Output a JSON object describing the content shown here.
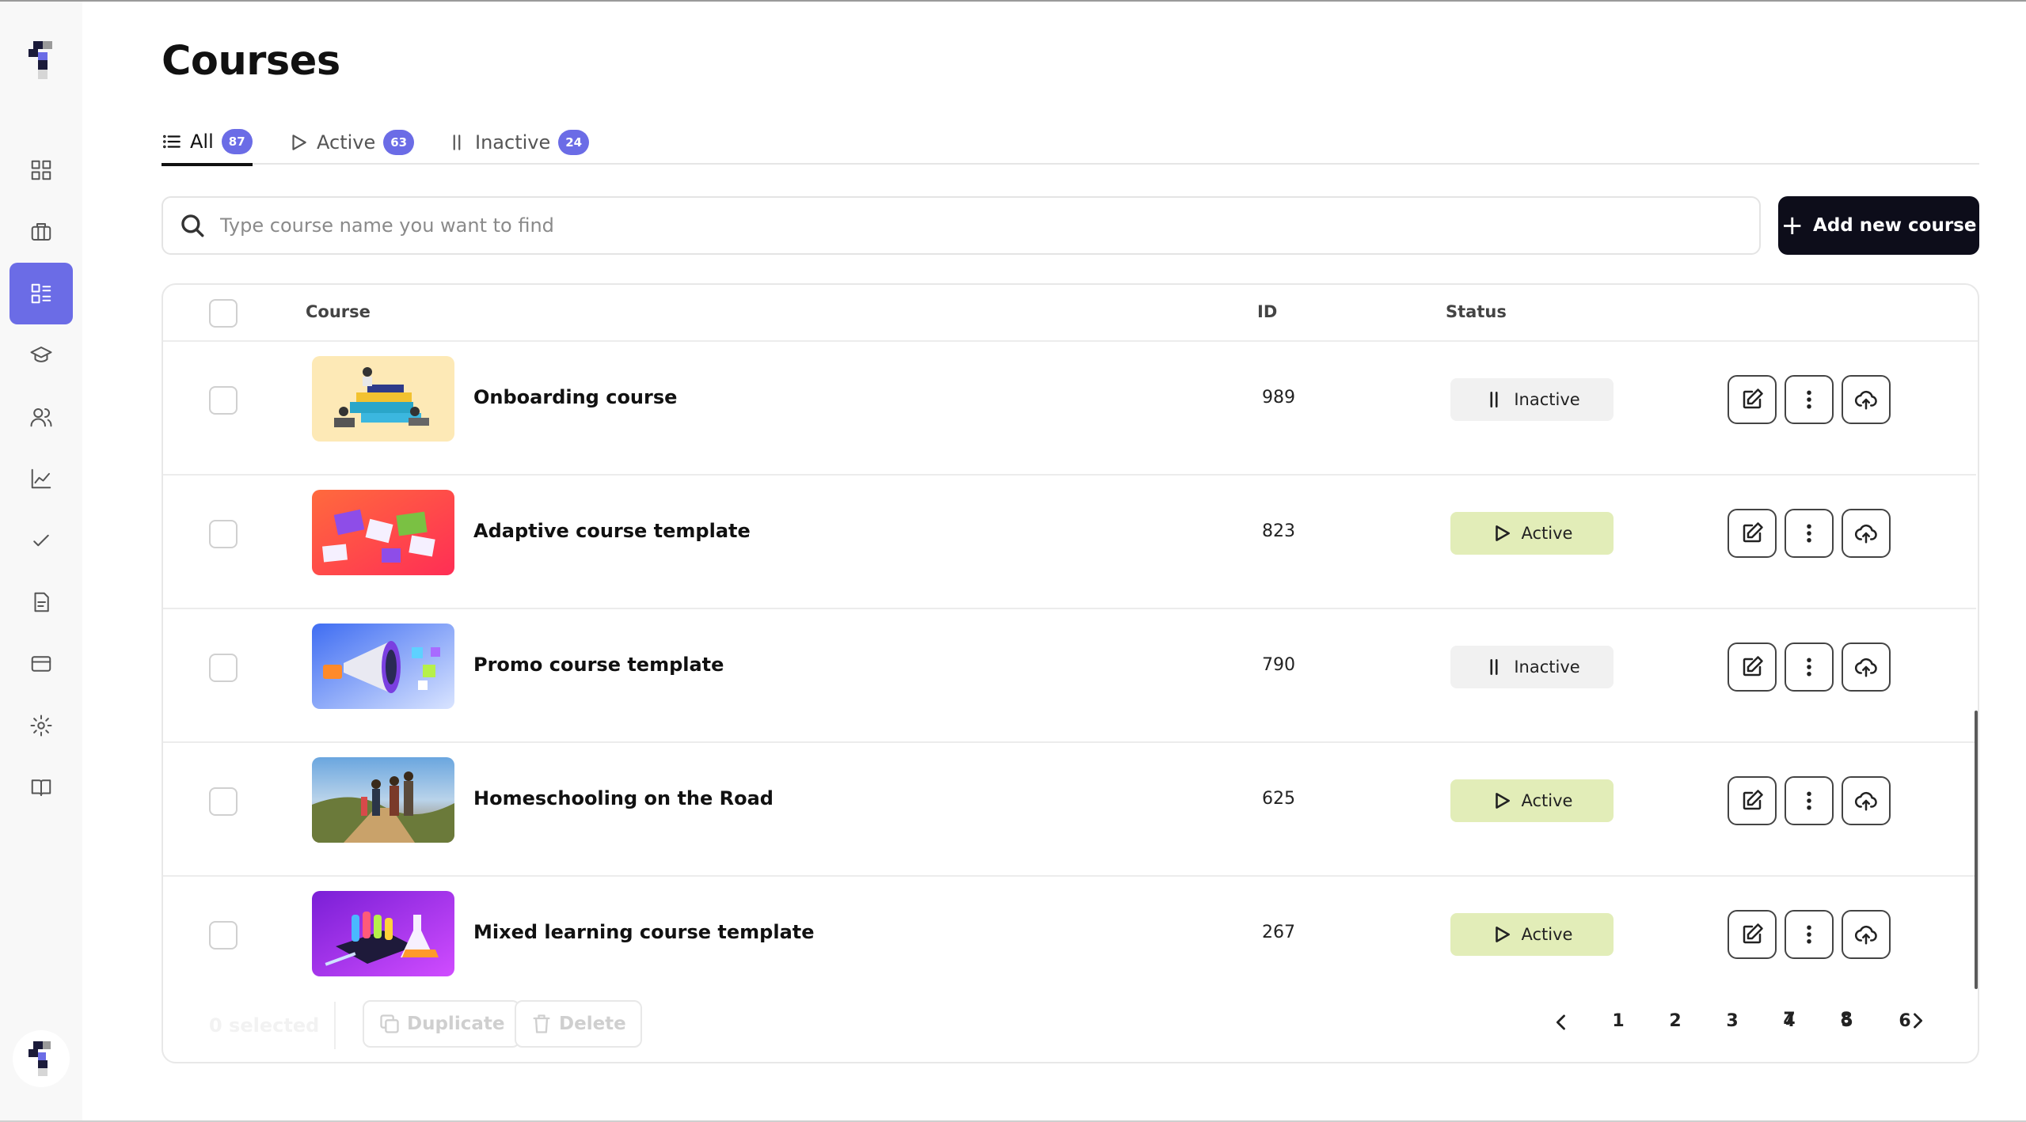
{
  "page": {
    "title": "Courses"
  },
  "tabs": [
    {
      "label": "All",
      "count": "87",
      "icon": "list-icon",
      "active": true
    },
    {
      "label": "Active",
      "count": "63",
      "icon": "play-icon",
      "active": false
    },
    {
      "label": "Inactive",
      "count": "24",
      "icon": "pause-icon",
      "active": false
    }
  ],
  "search": {
    "placeholder": "Type course name you want to find",
    "value": ""
  },
  "add_button": {
    "label": "Add new course"
  },
  "table": {
    "columns": {
      "course": "Course",
      "id": "ID",
      "status": "Status"
    },
    "rows": [
      {
        "title": "Onboarding course",
        "id": "989",
        "status": "Inactive",
        "status_kind": "inactive",
        "thumb": "people-on-books-illustration"
      },
      {
        "title": "Adaptive course template",
        "id": "823",
        "status": "Active",
        "status_kind": "active",
        "thumb": "puzzle-pieces-illustration"
      },
      {
        "title": "Promo course template",
        "id": "790",
        "status": "Inactive",
        "status_kind": "inactive",
        "thumb": "megaphone-illustration"
      },
      {
        "title": "Homeschooling on the Road",
        "id": "625",
        "status": "Active",
        "status_kind": "active",
        "thumb": "hikers-photo"
      },
      {
        "title": "Mixed learning course template",
        "id": "267",
        "status": "Active",
        "status_kind": "active",
        "thumb": "lab-flasks-illustration"
      }
    ]
  },
  "footer": {
    "selected": "0 selected",
    "duplicate": "Duplicate",
    "delete": "Delete",
    "pages": [
      "1",
      "2",
      "3",
      "4",
      "5",
      "6",
      "7",
      "8"
    ]
  },
  "colors": {
    "accent": "#6b6ce6",
    "primary_button": "#0d0d1a",
    "active_status_bg": "#e2edb8",
    "inactive_status_bg": "#f1f1f1"
  }
}
